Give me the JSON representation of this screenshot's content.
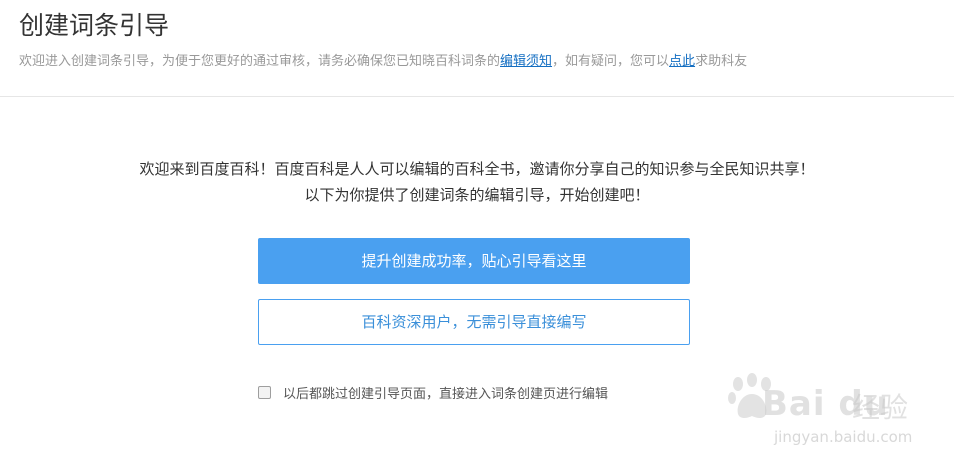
{
  "header": {
    "title": "创建词条引导",
    "subtitle_part1": "欢迎进入创建词条引导，为便于您更好的通过审核，请务必确保您已知晓百科词条的",
    "link_edit_rules": "编辑须知",
    "subtitle_part2": "，如有疑问，您可以",
    "link_click_here": "点此",
    "subtitle_part3": "求助科友"
  },
  "main": {
    "welcome_line1": "欢迎来到百度百科！百度百科是人人可以编辑的百科全书，邀请你分享自己的知识参与全民知识共享！",
    "welcome_line2": "以下为你提供了创建词条的编辑引导，开始创建吧！",
    "primary_button": "提升创建成功率，贴心引导看这里",
    "secondary_button": "百科资深用户，无需引导直接编写",
    "skip_checkbox_label": "以后都跳过创建引导页面，直接进入词条创建页进行编辑",
    "skip_checked": false
  },
  "watermark": {
    "brand": "Bai du",
    "brand_cn": "经验",
    "url": "jingyan.baidu.com",
    "icon": "baidu-paw-icon"
  },
  "colors": {
    "accent": "#4aa0f0",
    "link": "#136ec2",
    "muted_text": "#999999"
  }
}
